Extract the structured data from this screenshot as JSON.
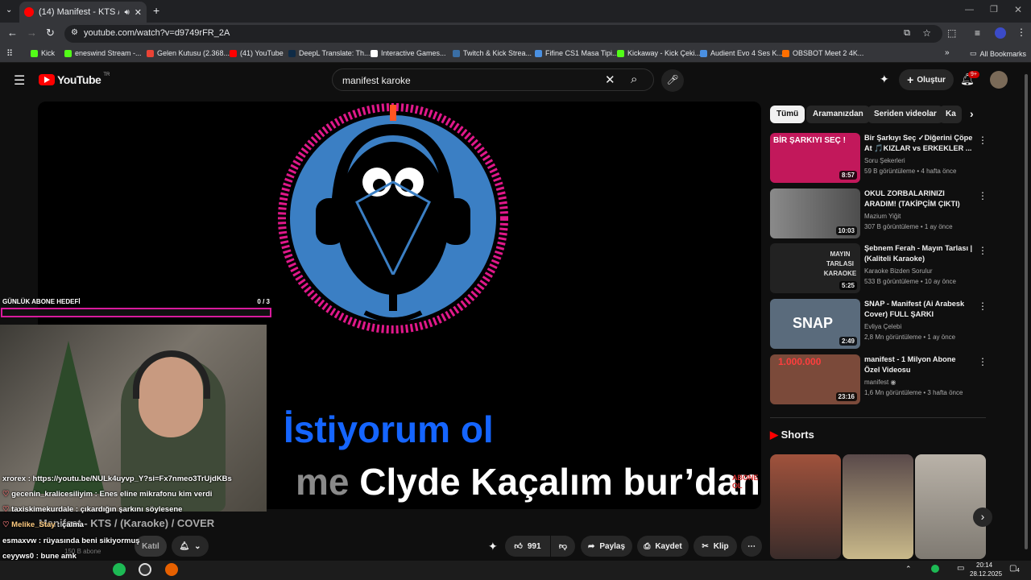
{
  "browser": {
    "tab_title": "(14) Manifest - KTS / (Karaoke)",
    "url": "youtube.com/watch?v=d9749rFR_2A",
    "bookmarks": [
      "Kick",
      "eneswind Stream -...",
      "Gelen Kutusu (2.368...",
      "(41) YouTube",
      "DeepL Translate: Th...",
      "Interactive Games...",
      "Twitch & Kick Strea...",
      "Fifine CS1 Masa Tipi...",
      "Kickaway - Kick Çeki...",
      "Audient Evo 4 Ses K...",
      "OBSBOT Meet 2 4K..."
    ],
    "all_bookmarks": "All Bookmarks"
  },
  "youtube": {
    "logo": "YouTube",
    "logo_country": "TR",
    "search_value": "manifest karoke",
    "create_label": "Oluştur",
    "notif_count": "9+"
  },
  "video": {
    "lyric_line1": "İstiyorum ol",
    "lyric_line2_prefix": "me ",
    "lyric_line2": "Clyde Kaçalım bur’dan",
    "corner_badge": "ABONE OL"
  },
  "stream_overlay": {
    "goal_label": "GÜNLÜK ABONE HEDEFİ",
    "goal_value": "0 / 3",
    "goal_progress": 0
  },
  "chat": [
    {
      "user": "xrorex",
      "msg": "https://youtu.be/NULk4uyvp_Y?si=Fx7nmeo3TrUjdKBs"
    },
    {
      "user": "gecenin_kralicesiliyim",
      "msg": "Enes eline mikrafonu kim verdi"
    },
    {
      "user": "taxiskimekurdale",
      "msg": "çıkardığın şarkını söylesene"
    },
    {
      "user": "Melike_Stay",
      "msg": "çalma"
    },
    {
      "user": "esmaxvw",
      "msg": "rüyasında beni sikiyormuş"
    },
    {
      "user": "ceyyws0",
      "msg": "bune amk"
    },
    {
      "user": "gecenin_kralicesiliyim",
      "msg": ""
    }
  ],
  "below_video": {
    "title_partial": "Manifest - KTS / (Karaoke) / COVER",
    "subscribers": "150 B abone",
    "join_label": "Katıl",
    "likes": "991",
    "share_label": "Paylaş",
    "save_label": "Kaydet",
    "clip_label": "Klip"
  },
  "chips": [
    "Tümü",
    "Aramanızdan",
    "Seriden videolar",
    "Ka"
  ],
  "recommendations": [
    {
      "title": "Bir Şarkıyı Seç ✓Diğerini Çöpe At 🎵KIZLAR vs ERKEKLER ...",
      "channel": "Soru Şekerleri",
      "meta": "59 B görüntüleme • 4 hafta önce",
      "duration": "8:57",
      "color": "#c2185b",
      "thumb_text": "BİR ŞARKIYI SEÇ !"
    },
    {
      "title": "OKUL ZORBALARINIZI ARADIM! (TAKİPÇİM ÇIKTI)",
      "channel": "Mazium Yiğit",
      "meta": "307 B görüntüleme • 1 ay önce",
      "duration": "10:03",
      "color": "#6d6d6d",
      "thumb_text": ""
    },
    {
      "title": "Şebnem Ferah - Mayın Tarlası | (Kaliteli Karaoke)",
      "channel": "Karaoke Bizden Sorulur",
      "meta": "533 B görüntüleme • 10 ay önce",
      "duration": "5:25",
      "color": "#222222",
      "thumb_text": "MAYIN TARLASI KARAOKE"
    },
    {
      "title": "SNAP - Manifest (Ai Arabesk Cover) FULL ŞARKI",
      "channel": "Evliya Çelebi",
      "meta": "2,8 Mn görüntüleme • 1 ay önce",
      "duration": "2:49",
      "color": "#5a6b7c",
      "thumb_text": "SNAP"
    },
    {
      "title": "manifest - 1 Milyon Abone Özel Videosu",
      "channel": "manifest",
      "meta": "1,6 Mn görüntüleme • 3 hafta önce",
      "duration": "23:16",
      "color": "#7b4a3a",
      "thumb_text": "1.000.000"
    }
  ],
  "shorts_title": "Shorts",
  "taskbar": {
    "time": "20:14",
    "date": "28.12.2025",
    "notif": "4"
  },
  "colors": {
    "accent_red": "#ff0000",
    "lyric_blue": "#1565ff",
    "goal_border": "#d81b9d"
  }
}
